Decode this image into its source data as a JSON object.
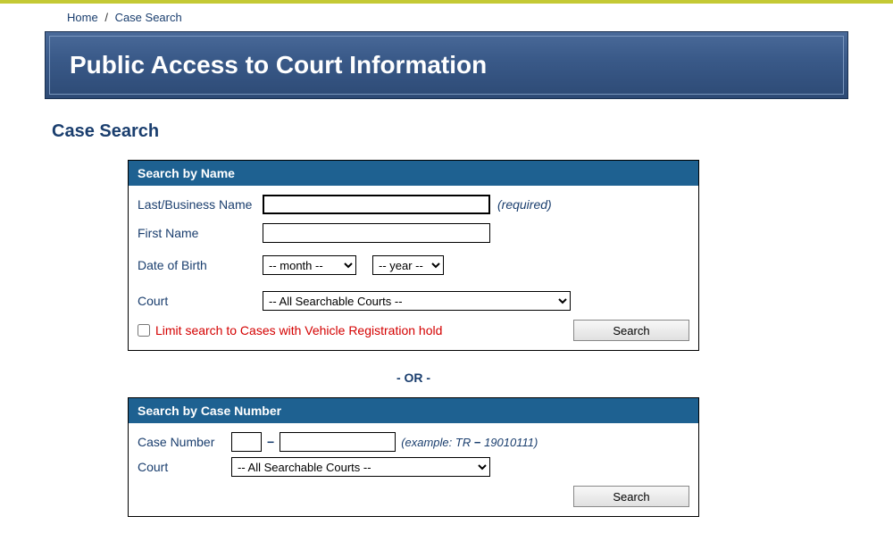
{
  "breadcrumb": {
    "home": "Home",
    "current": "Case Search"
  },
  "banner": {
    "title": "Public Access to Court Information"
  },
  "page": {
    "heading": "Case Search"
  },
  "searchByName": {
    "header": "Search by Name",
    "labels": {
      "lastName": "Last/Business Name",
      "firstName": "First Name",
      "dob": "Date of Birth",
      "court": "Court"
    },
    "required": "(required)",
    "monthOption": "-- month --",
    "yearOption": "-- year --",
    "courtOption": "-- All Searchable Courts --",
    "limitLabel": "Limit search to Cases with Vehicle Registration hold",
    "searchBtn": "Search"
  },
  "orText": "- OR -",
  "searchByCase": {
    "header": "Search by Case Number",
    "labels": {
      "caseNumber": "Case Number",
      "court": "Court"
    },
    "exampleText": "(example: TR",
    "exampleSep": "−",
    "exampleNum": "19010111)",
    "courtOption": "-- All Searchable Courts --",
    "searchBtn": "Search"
  }
}
